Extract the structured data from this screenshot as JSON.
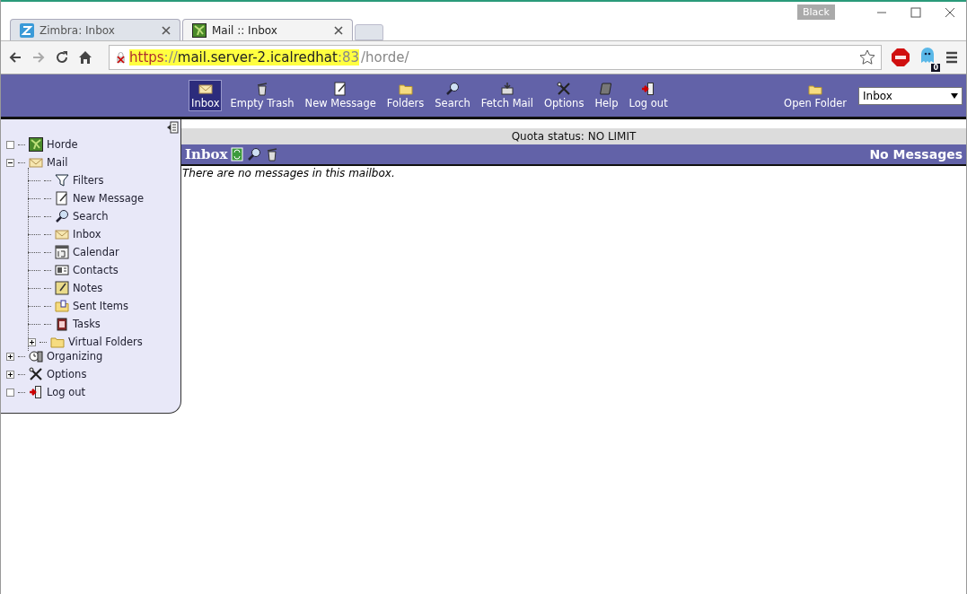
{
  "browser": {
    "profile": "Black",
    "tabs": [
      {
        "title": "Zimbra: Inbox",
        "selected": false
      },
      {
        "title": "Mail :: Inbox",
        "selected": true
      }
    ],
    "address": {
      "scheme": "https",
      "rest_of_scheme": "://",
      "host": "mail.server-2.icalredhat",
      "port": ":83",
      "path": "/horde/",
      "insecure": true
    },
    "extension_badge": "0"
  },
  "toolbar": {
    "items": [
      {
        "label": "Inbox",
        "selected": true
      },
      {
        "label": "Empty Trash",
        "selected": false
      },
      {
        "label": "New Message",
        "selected": false
      },
      {
        "label": "Folders",
        "selected": false
      },
      {
        "label": "Search",
        "selected": false
      },
      {
        "label": "Fetch Mail",
        "selected": false
      },
      {
        "label": "Options",
        "selected": false
      },
      {
        "label": "Help",
        "selected": false
      },
      {
        "label": "Log out",
        "selected": false
      }
    ],
    "open_folder": {
      "label": "Open Folder"
    },
    "folder_select": {
      "value": "Inbox"
    }
  },
  "sidebar": {
    "items": [
      {
        "label": "Horde",
        "expandable": false
      },
      {
        "label": "Mail",
        "expandable": true,
        "expanded": true,
        "children": [
          {
            "label": "Filters"
          },
          {
            "label": "New Message"
          },
          {
            "label": "Search"
          },
          {
            "label": "Inbox"
          },
          {
            "label": "Calendar"
          },
          {
            "label": "Contacts"
          },
          {
            "label": "Notes"
          },
          {
            "label": "Sent Items"
          },
          {
            "label": "Tasks"
          },
          {
            "label": "Virtual Folders",
            "expandable": true,
            "expanded": false
          }
        ]
      },
      {
        "label": "Organizing",
        "expandable": true,
        "expanded": false
      },
      {
        "label": "Options",
        "expandable": true,
        "expanded": false
      },
      {
        "label": "Log out",
        "expandable": false
      }
    ]
  },
  "quota": "Quota status: NO LIMIT",
  "mailbox": {
    "title": "Inbox",
    "status": "No Messages",
    "empty_text": "There are no messages in this mailbox."
  }
}
